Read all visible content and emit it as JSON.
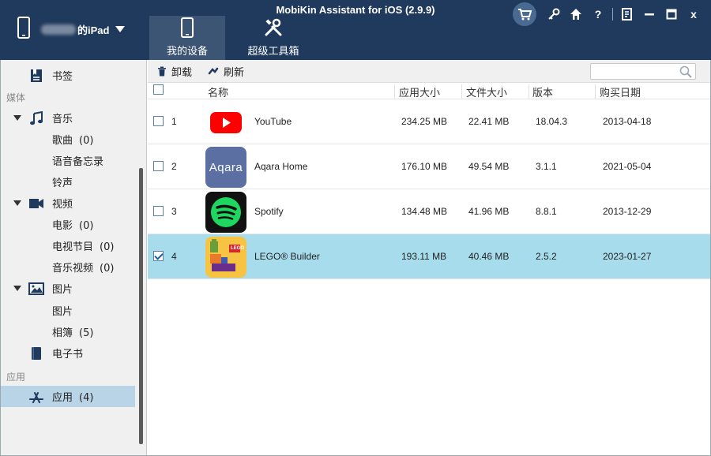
{
  "window": {
    "title": "MobiKin Assistant for iOS (2.9.9)"
  },
  "device": {
    "name_suffix": "的iPad"
  },
  "nav_tabs": [
    {
      "label": "我的设备",
      "icon": "tablet-icon",
      "active": true
    },
    {
      "label": "超级工具箱",
      "icon": "tools-icon",
      "active": false
    }
  ],
  "window_controls": {
    "help_label": "?",
    "close_label": "x"
  },
  "sidebar": {
    "bookmarks": "书签",
    "cat_media": "媒体",
    "music": "音乐",
    "songs": "歌曲",
    "songs_count": "(0)",
    "voice_memos": "语音备忘录",
    "ringtones": "铃声",
    "video": "视频",
    "movies": "电影",
    "movies_count": "(0)",
    "tv_shows": "电视节目",
    "tv_shows_count": "(0)",
    "music_videos": "音乐视频",
    "music_videos_count": "(0)",
    "photos": "图片",
    "photos_sub": "图片",
    "albums": "相簿",
    "albums_count": "(5)",
    "ebooks": "电子书",
    "cat_apps": "应用",
    "apps": "应用",
    "apps_count": "(4)"
  },
  "toolbar": {
    "uninstall_label": "卸载",
    "refresh_label": "刷新",
    "search_value": ""
  },
  "table": {
    "columns": [
      "名称",
      "应用大小",
      "文件大小",
      "版本",
      "购买日期"
    ],
    "rows": [
      {
        "index": "1",
        "name": "YouTube",
        "app_size": "234.25 MB",
        "file_size": "22.41 MB",
        "version": "18.04.3",
        "date": "2013-04-18",
        "checked": false,
        "icon": "youtube-icon"
      },
      {
        "index": "2",
        "name": "Aqara Home",
        "app_size": "176.10 MB",
        "file_size": "49.54 MB",
        "version": "3.1.1",
        "date": "2021-05-04",
        "checked": false,
        "icon": "aqara-icon",
        "icon_text": "Aqara"
      },
      {
        "index": "3",
        "name": "Spotify",
        "app_size": "134.48 MB",
        "file_size": "41.96 MB",
        "version": "8.8.1",
        "date": "2013-12-29",
        "checked": false,
        "icon": "spotify-icon"
      },
      {
        "index": "4",
        "name": "LEGO® Builder",
        "app_size": "193.11 MB",
        "file_size": "40.46 MB",
        "version": "2.5.2",
        "date": "2023-01-27",
        "checked": true,
        "icon": "lego-icon",
        "icon_text": "LEGO"
      }
    ]
  },
  "colors": {
    "header_bg": "#1f3a5c",
    "selected_row": "#a7dcec",
    "sidebar_selected": "#b9d4e6"
  }
}
